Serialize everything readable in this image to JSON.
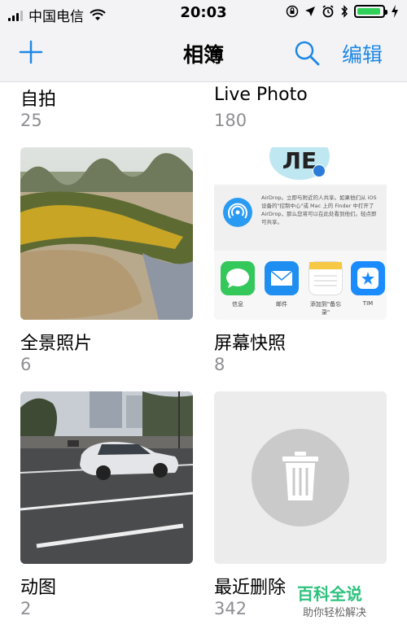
{
  "status_bar": {
    "carrier": "中国电信",
    "time": "20:03",
    "battery_color": "#2fd158"
  },
  "nav": {
    "title": "相簿",
    "edit_label": "编辑",
    "accent": "#1e88e5"
  },
  "albums": [
    {
      "name": "自拍",
      "count": "25"
    },
    {
      "name": "Live Photo",
      "count": "180"
    },
    {
      "name": "全景照片",
      "count": "6"
    },
    {
      "name": "屏幕快照",
      "count": "8"
    },
    {
      "name": "动图",
      "count": "2"
    },
    {
      "name": "最近删除",
      "count": "342"
    }
  ],
  "share_sheet": {
    "airdrop_text": "AirDrop。立即与附近的人共享。如果他们从 iOS 设备的\"控制中心\"或 Mac 上的 Finder 中打开了 AirDrop，那么您将可以在此处看到他们。轻点即可共享。",
    "apps": [
      {
        "label": "信息",
        "icon": "messages-icon"
      },
      {
        "label": "邮件",
        "icon": "mail-icon"
      },
      {
        "label": "添加到\"备忘录\"",
        "icon": "notes-icon"
      },
      {
        "label": "TIM",
        "icon": "tim-icon"
      }
    ],
    "header_text": "ЛЕ"
  },
  "watermark": {
    "title": "百科全说",
    "subtitle": "助你轻松解决"
  }
}
